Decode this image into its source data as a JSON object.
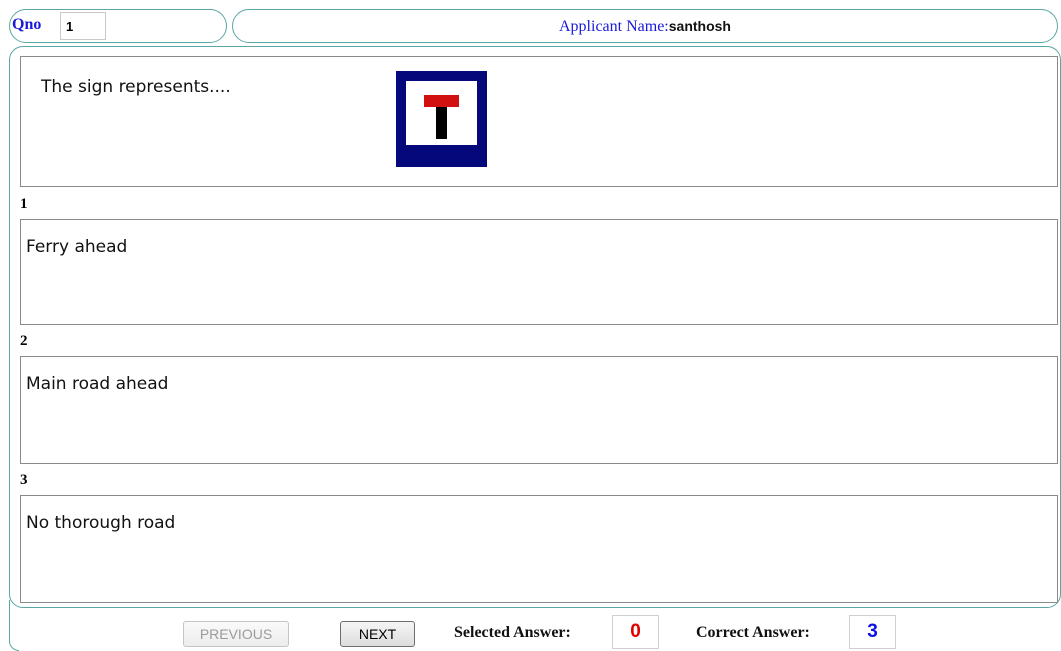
{
  "header": {
    "qno_label": "Qno",
    "qno_value": "1",
    "applicant_label": "Applicant Name:",
    "applicant_name": "santhosh"
  },
  "question": {
    "text": "The sign represents....",
    "image_icon": "t-road-sign-icon"
  },
  "options": [
    {
      "number": "1",
      "text": "Ferry ahead"
    },
    {
      "number": "2",
      "text": "Main road ahead"
    },
    {
      "number": "3",
      "text": "No thorough road"
    }
  ],
  "footer": {
    "previous_label": "PREVIOUS",
    "next_label": "NEXT",
    "selected_label": "Selected Answer:",
    "selected_value": "0",
    "correct_label": "Correct Answer:",
    "correct_value": "3"
  },
  "colors": {
    "accent_border": "#5aa6a6",
    "label_blue": "#1a1adb",
    "selected_red": "#e00000",
    "correct_blue": "#1010e0",
    "sign_blue": "#04087a",
    "sign_red": "#d11010"
  }
}
